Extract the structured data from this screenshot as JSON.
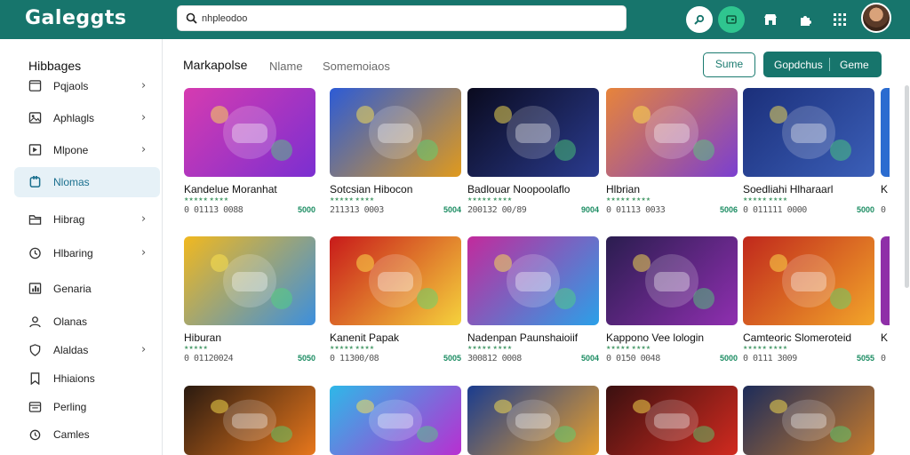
{
  "header": {
    "logo": "Galeggts",
    "search": {
      "value": "nhpleodoo",
      "placeholder": ""
    },
    "icons": [
      "link-icon",
      "wallet-icon",
      "store-icon",
      "puzzle-icon",
      "grid-icon"
    ],
    "colors": {
      "bar": "#17756c",
      "accent": "#2fc58f"
    }
  },
  "sidebar": {
    "title": "Hibbages",
    "items": [
      {
        "label": "Pqjaols",
        "icon": "window-icon",
        "chevron": true,
        "active": false
      },
      {
        "label": "Aphlagls",
        "icon": "image-icon",
        "chevron": true,
        "active": false
      },
      {
        "label": "Mlpone",
        "icon": "media-icon",
        "chevron": true,
        "active": false
      },
      {
        "label": "Nlomas",
        "icon": "tag-icon",
        "chevron": false,
        "active": true
      },
      {
        "label": "Hibrag",
        "icon": "folder-icon",
        "chevron": true,
        "active": false
      },
      {
        "label": "Hlbaring",
        "icon": "clock-icon",
        "chevron": true,
        "active": false
      },
      {
        "label": "Genaria",
        "icon": "chart-icon",
        "chevron": false,
        "active": false
      },
      {
        "label": "Olanas",
        "icon": "user-icon",
        "chevron": false,
        "active": false
      },
      {
        "label": "Alaldas",
        "icon": "shield-icon",
        "chevron": true,
        "active": false
      },
      {
        "label": "Hhiaions",
        "icon": "bookmark-icon",
        "chevron": false,
        "active": false
      },
      {
        "label": "Perling",
        "icon": "calendar-icon",
        "chevron": false,
        "active": false
      },
      {
        "label": "Camles",
        "icon": "clock2-icon",
        "chevron": false,
        "active": false
      }
    ]
  },
  "main": {
    "tabs": [
      "Markapolse",
      "Nlame",
      "Somemoiaos"
    ],
    "buttons": {
      "outline": "Sume",
      "split_a": "Gopdchus",
      "split_b": "Geme"
    },
    "cards": [
      {
        "title": "Kandelue Moranhat",
        "rating": "★★★★★ ★★★★",
        "meta": "0 01113 0088",
        "price": "5000",
        "bg": "#d63bb0",
        "bg2": "#7b2fd1",
        "icon": "puzzle-game-icon"
      },
      {
        "title": "Sotcsian Hibocon",
        "rating": "★★★★★ ★★★★",
        "meta": "211313 0003",
        "price": "5004",
        "bg": "#2c5bd6",
        "bg2": "#e09a1d",
        "icon": "title-card-icon"
      },
      {
        "title": "Badlouar Noopoolaflo",
        "rating": "★★★★★ ★★★★",
        "meta": "200132 00/89",
        "price": "9004",
        "bg": "#0a0a1e",
        "bg2": "#2a3b8f",
        "icon": "gamepad-icon"
      },
      {
        "title": "Hlbrian",
        "rating": "★★★★★ ★★★★",
        "meta": "0 01113 0033",
        "price": "5006",
        "bg": "#e7843a",
        "bg2": "#7b3fd0",
        "icon": "adventure-icon"
      },
      {
        "title": "Soedliahi Hlharaarl",
        "rating": "★★★★★ ★★★★",
        "meta": "0 011111 0000",
        "price": "5000",
        "bg": "#1b2f7a",
        "bg2": "#3b5fb8",
        "icon": "warrior-icon"
      },
      {
        "title": "Hiburan",
        "rating": "★★★★★",
        "meta": "0 01120024",
        "price": "5050",
        "bg": "#f1b81f",
        "bg2": "#3c8fdd",
        "icon": "party-icon"
      },
      {
        "title": "Kanenit Papak",
        "rating": "★★★★★ ★★★★",
        "meta": "0 11300/08",
        "price": "5005",
        "bg": "#c81a1a",
        "bg2": "#f5d23c",
        "icon": "controller-icon"
      },
      {
        "title": "Nadenpan Paunshaioiif",
        "rating": "★★★★★ ★★★★",
        "meta": "300812 0008",
        "price": "5004",
        "bg": "#c22a9c",
        "bg2": "#2ba0e8",
        "icon": "heroes-icon"
      },
      {
        "title": "Kappono Vee lologin",
        "rating": "★★★★★ ★★★★",
        "meta": "0 0150 0048",
        "price": "5000",
        "bg": "#2a1d4f",
        "bg2": "#8f2fb0",
        "icon": "sword-icon"
      },
      {
        "title": "Camteoric Slomeroteid",
        "rating": "★★★★★ ★★★★",
        "meta": "0 0111 3009",
        "price": "5055",
        "bg": "#c0281c",
        "bg2": "#f2a52a",
        "icon": "battle-icon"
      },
      {
        "title": "",
        "rating": "",
        "meta": "",
        "price": "",
        "bg": "#2a1a10",
        "bg2": "#e7771c",
        "icon": "fox-icon"
      },
      {
        "title": "",
        "rating": "",
        "meta": "",
        "price": "",
        "bg": "#2eb8e8",
        "bg2": "#b82fd1",
        "icon": "candy-icon"
      },
      {
        "title": "",
        "rating": "",
        "meta": "",
        "price": "",
        "bg": "#1a3c8f",
        "bg2": "#e89f2c",
        "icon": "kids-icon"
      },
      {
        "title": "",
        "rating": "",
        "meta": "",
        "price": "",
        "bg": "#3a1010",
        "bg2": "#d12a1f",
        "icon": "villain-icon"
      },
      {
        "title": "",
        "rating": "",
        "meta": "",
        "price": "",
        "bg": "#1d2c5a",
        "bg2": "#c57a2c",
        "icon": "dwarf-icon"
      }
    ],
    "edge_cards": [
      {
        "title": "K",
        "meta": "0",
        "bg": "#2b6cd0"
      },
      {
        "title": "K",
        "meta": "0",
        "bg": "#8f2fa8"
      }
    ]
  }
}
